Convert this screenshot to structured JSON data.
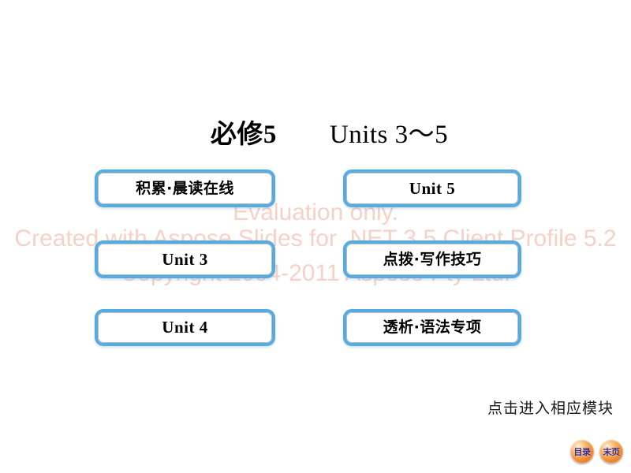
{
  "slide": {
    "title_cn": "必修5",
    "title_gap": "　　",
    "title_en": "Units 3～5",
    "title_full": "必修5　　Units 3～5",
    "footer_note": "点击进入相应模块",
    "background_color": "#ffffff",
    "accent_color": "#53ace4"
  },
  "buttons": [
    {
      "label": "积累·晨读在线",
      "script": "cn",
      "column": "left",
      "row": 1
    },
    {
      "label": "Unit 5",
      "script": "en",
      "column": "right",
      "row": 1
    },
    {
      "label": "Unit 3",
      "script": "en",
      "column": "left",
      "row": 2
    },
    {
      "label": "点拨·写作技巧",
      "script": "cn",
      "column": "right",
      "row": 2
    },
    {
      "label": "Unit 4",
      "script": "en",
      "column": "left",
      "row": 3
    },
    {
      "label": "透析·语法专项",
      "script": "cn",
      "column": "right",
      "row": 3
    }
  ],
  "nav_badges": [
    {
      "label": "目录",
      "name": "contents"
    },
    {
      "label": "末页",
      "name": "last-page"
    }
  ],
  "watermark": {
    "line1": "Evaluation only.",
    "line2": "Created with Aspose.Slides for .NET 3.5 Client Profile 5.2",
    "line3": "Copyright 2004-2011 Aspose Pty Ltd.",
    "color": "#f6cfc4"
  }
}
